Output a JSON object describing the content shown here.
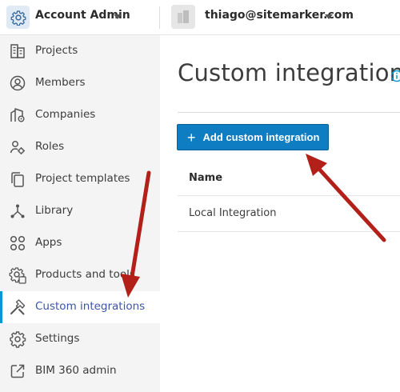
{
  "header": {
    "account_label": "Account Admin",
    "user_email": "thiago@sitemarker.com",
    "logo_icon": "gear-icon",
    "project_thumbnail_icon": "building-icon"
  },
  "sidebar": {
    "items": [
      {
        "label": "Projects",
        "icon": "building-icon",
        "active": false
      },
      {
        "label": "Members",
        "icon": "user-circle-icon",
        "active": false
      },
      {
        "label": "Companies",
        "icon": "company-icon",
        "active": false
      },
      {
        "label": "Roles",
        "icon": "person-gear-icon",
        "active": false
      },
      {
        "label": "Project templates",
        "icon": "copy-icon",
        "active": false
      },
      {
        "label": "Library",
        "icon": "library-icon",
        "active": false
      },
      {
        "label": "Apps",
        "icon": "apps-grid-icon",
        "active": false
      },
      {
        "label": "Products and tools",
        "icon": "gear-badge-icon",
        "active": false
      },
      {
        "label": "Custom integrations",
        "icon": "tools-icon",
        "active": true
      },
      {
        "label": "Settings",
        "icon": "gear-icon",
        "active": false
      },
      {
        "label": "BIM 360 admin",
        "icon": "external-link-icon",
        "active": false
      }
    ]
  },
  "main": {
    "title": "Custom integrations",
    "add_button_label": "Add custom integration",
    "add_button_icon": "plus-icon",
    "info_icon": "info-icon",
    "table": {
      "columns": [
        "Name"
      ],
      "rows": [
        [
          "Local Integration"
        ]
      ]
    }
  },
  "colors": {
    "primary_button": "#0f7dc2",
    "active_accent": "#0696d7",
    "active_text": "#3b55a8",
    "sidebar_bg": "#f4f4f4",
    "annotation_arrow": "#b3201a"
  }
}
